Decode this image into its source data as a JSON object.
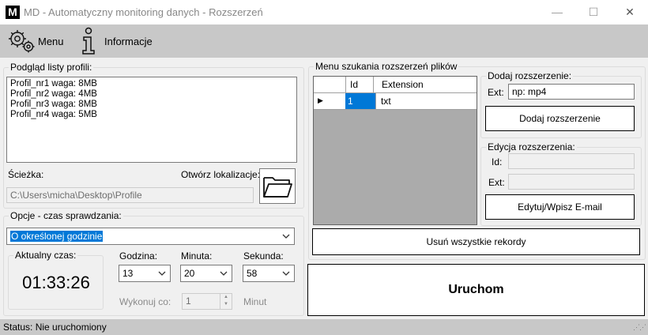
{
  "window": {
    "title": "MD - Automatyczny monitoring danych - Rozszerzeń",
    "app_icon_letter": "M",
    "minimize": "—",
    "maximize": "☐",
    "close": "✕"
  },
  "menubar": {
    "items": [
      {
        "label": "Menu",
        "icon": "gears-icon"
      },
      {
        "label": "Informacje",
        "icon": "info-icon"
      }
    ]
  },
  "profiles": {
    "group_title": "Podgląd listy profili:",
    "items": [
      "Profil_nr1 waga: 8MB",
      "Profil_nr2 waga: 4MB",
      "Profil_nr3 waga: 8MB",
      "Profil_nr4 waga: 5MB"
    ],
    "path_label": "Ścieżka:",
    "open_location_label": "Otwórz lokalizacje:",
    "path_value": "C:\\Users\\micha\\Desktop\\Profile"
  },
  "options": {
    "group_title": "Opcje - czas sprawdzania:",
    "mode_selected": "O określonej godzinie",
    "current_time_title": "Aktualny czas:",
    "current_time": "01:33:26",
    "hour_label": "Godzina:",
    "hour_value": "13",
    "minute_label": "Minuta:",
    "minute_value": "20",
    "second_label": "Sekunda:",
    "second_value": "58",
    "repeat_label": "Wykonuj co:",
    "repeat_value": "1",
    "repeat_unit": "Minut"
  },
  "extensions": {
    "group_title": "Menu szukania rozszerzeń plików",
    "grid": {
      "columns": [
        "Id",
        "Extension"
      ],
      "rows": [
        {
          "id": "1",
          "ext": "txt"
        }
      ]
    },
    "add_group_title": "Dodaj rozszerzenie:",
    "ext_label": "Ext:",
    "ext_value": "np: mp4",
    "add_button": "Dodaj rozszerzenie",
    "edit_group_title": "Edycja rozszerzenia:",
    "edit_id_label": "Id:",
    "edit_ext_label": "Ext:",
    "edit_button": "Edytuj/Wpisz E-mail",
    "delete_all_button": "Usuń wszystkie rekordy",
    "run_button": "Uruchom"
  },
  "status": {
    "text": "Status: Nie uruchomiony"
  },
  "colors": {
    "selection": "#0078d7",
    "menubar": "#c8c8c8",
    "grid_bg": "#ababab"
  }
}
